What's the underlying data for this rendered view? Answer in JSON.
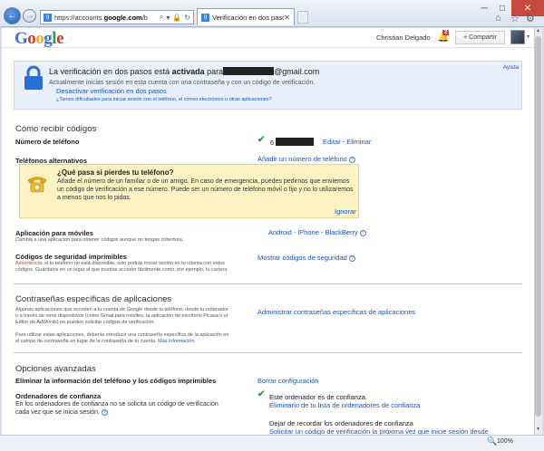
{
  "browser": {
    "url_prefix": "https://accounts.",
    "url_domain": "google.com",
    "url_suffix": "/b",
    "tab_title": "Verificación en dos pasos",
    "min_glyph": "─",
    "max_glyph": "□",
    "close_glyph": "✕",
    "back_glyph": "←",
    "fwd_glyph": "→",
    "search_glyph": "⌕",
    "dropdown_glyph": "▾",
    "lock_glyph": "🔒",
    "refresh_glyph": "↻",
    "tab_close_glyph": "✕",
    "home_glyph": "⌂",
    "star_glyph": "☆",
    "gear_glyph": "⚙",
    "zoom": "100%",
    "zoom_glyph": "🔍"
  },
  "header": {
    "logo_letters": [
      "G",
      "o",
      "o",
      "g",
      "l",
      "e"
    ],
    "user_name": "Christian Delgado",
    "notification_count": "2",
    "bell_glyph": "🔔",
    "share_label": "+ Compartir",
    "caret": "▾"
  },
  "banner": {
    "title_prefix": "La verificación en dos pasos está ",
    "title_bold": "activada",
    "title_mid": " para",
    "title_suffix": "@gmail.com",
    "subtitle": "Actualmente inicias sesión en esta cuenta con una contraseña y con un código de verificación.",
    "deactivate_link": "Desactivar verificación en dos pasos",
    "help_link": "¿Tienes dificultades para iniciar sesión con el teléfono, el correo electrónico u otras aplicaciones?",
    "ayuda": "Ayuda"
  },
  "receive": {
    "section_title": "Cómo recibir códigos",
    "phone_label": "Número de teléfono",
    "phone_digit": "6",
    "phone_actions": "Editar - Eliminar",
    "alt_label": "Teléfonos alternativos",
    "alt_link": "Añadir un número de teléfono",
    "warn_title": "¿Qué pasa si pierdes tu teléfono?",
    "warn_body": "Añade el número de un familiar o de un amigo. En caso de emergencia, puedes pedirnos que enviemos un código de verificación a ese número. Puede ser un número de teléfono móvil o fijo y no lo utilizaremos a menos que nos lo pidas.",
    "warn_ignore": "Ignorar",
    "mobile_label": "Aplicación para móviles",
    "mobile_desc": "Cambia a una aplicación para obtener códigos aunque no tengas cobertura.",
    "mobile_links": "Android - iPhone - BlackBerry",
    "backup_label": "Códigos de seguridad imprimibles",
    "backup_warn": "Advertencia",
    "backup_desc_1": ": si tu teléfono no está disponible, solo podrás iniciar sesión en tu cuenta con estos",
    "backup_desc_2": "códigos. Guárdalos en un lugar al que puedas acceder fácilmente como, por ejemplo, tu cartera.",
    "backup_link": "Mostrar códigos de seguridad"
  },
  "app_passwords": {
    "section_title": "Contraseñas específicas de aplicaciones",
    "desc_1": "Algunas aplicaciones que acceden a tu cuenta de Google desde tu teléfono, desde tu ordenador",
    "desc_2": "o a través de otros dispositivos (como Gmail para móviles, la aplicación de escritorio Picasa o el",
    "desc_3": "Editor de AdWords) no pueden solicitar códigos de verificación.",
    "desc_4": "Para utilizar estas aplicaciones, deberás introducir una contraseña específica de la aplicación en",
    "desc_5": "el campo de contraseña en lugar de la contraseña de tu cuenta.",
    "more_info": "Más información",
    "manage_link": "Administrar contraseñas específicas de aplicaciones"
  },
  "advanced": {
    "section_title": "Opciones avanzadas",
    "remove_label": "Eliminar la información del teléfono y los códigos imprimibles",
    "remove_link": "Borrar configuración",
    "trusted_label": "Ordenadores de confianza",
    "trusted_desc_1": "En los ordenadores de confianza no se solicita un código de verificación",
    "trusted_desc_2": "cada vez que se inicia sesión.",
    "trusted_status": "Este ordenador es de confianza.",
    "trusted_remove_link": "Eliminarlo de tu lista de ordenadores de confianza",
    "stop_text": "Dejar de recordar los ordenadores de confianza",
    "stop_link": "Solicitar un código de verificación la próxima vez que inicie sesión desde"
  },
  "icons": {
    "check": "✔",
    "help": "?"
  }
}
